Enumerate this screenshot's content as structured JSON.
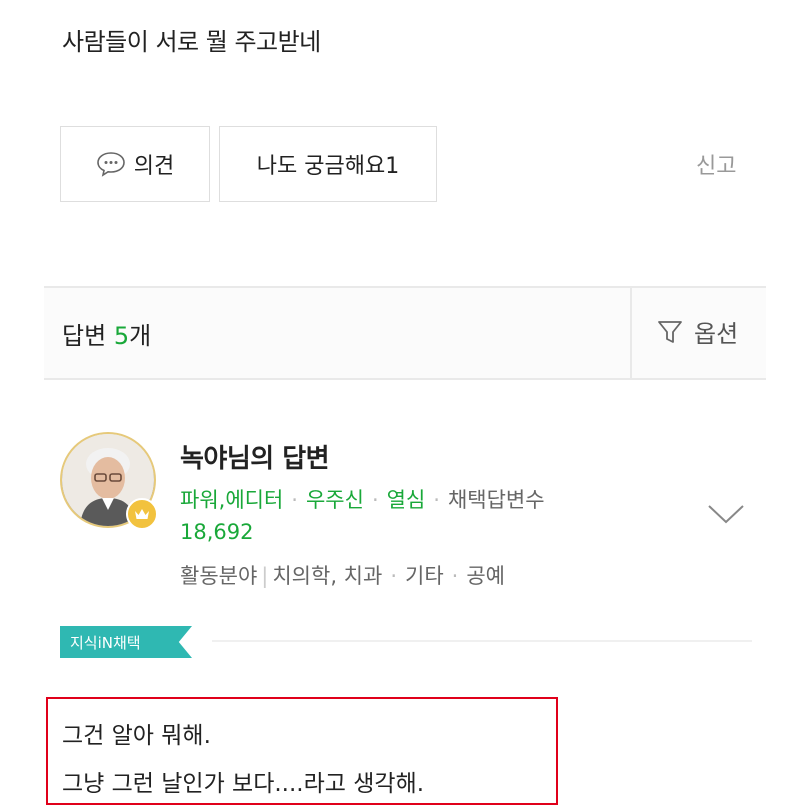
{
  "question": {
    "text": "사람들이 서로 뭘 주고받네"
  },
  "actions": {
    "opinion_label": "의견",
    "curious_label": "나도 궁금해요1",
    "report_label": "신고"
  },
  "answers_bar": {
    "label": "답변",
    "count": "5",
    "unit": "개",
    "option_label": "옵션"
  },
  "answer": {
    "author_title": "녹야님의 답변",
    "badges": [
      "파워,에디터",
      "우주신",
      "열심"
    ],
    "adopted_label": "채택답변수",
    "adopted_count": "18,692",
    "field_label": "활동분야",
    "fields": [
      "치의학, 치과",
      "기타",
      "공예"
    ],
    "adopted_tag": "지식iN채택",
    "body_lines": [
      "그건 알아 뭐해.",
      "그냥 그런 날인가 보다....라고 생각해."
    ]
  },
  "colors": {
    "accent_green": "#19a839",
    "tag_teal": "#2fb8b2",
    "highlight_red": "#e0001a"
  }
}
